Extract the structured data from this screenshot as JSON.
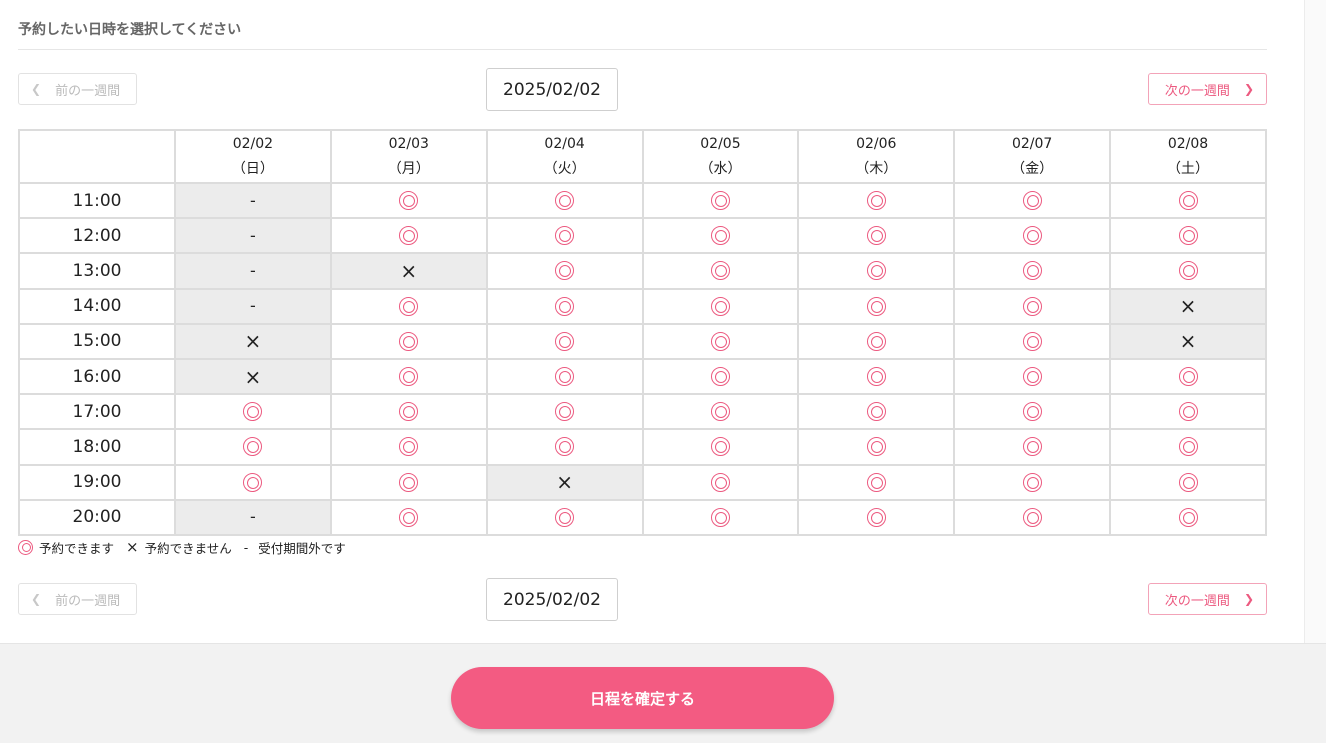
{
  "heading": "予約したい日時を選択してください",
  "nav": {
    "prev_label": "前の一週間",
    "next_label": "次の一週間",
    "current_date": "2025/02/02"
  },
  "days": [
    {
      "date": "02/02",
      "weekday": "（日）"
    },
    {
      "date": "02/03",
      "weekday": "（月）"
    },
    {
      "date": "02/04",
      "weekday": "（火）"
    },
    {
      "date": "02/05",
      "weekday": "（水）"
    },
    {
      "date": "02/06",
      "weekday": "（木）"
    },
    {
      "date": "02/07",
      "weekday": "（金）"
    },
    {
      "date": "02/08",
      "weekday": "（土）"
    }
  ],
  "slots": [
    {
      "time": "11:00",
      "status": [
        "na",
        "ok",
        "ok",
        "ok",
        "ok",
        "ok",
        "ok"
      ]
    },
    {
      "time": "12:00",
      "status": [
        "na",
        "ok",
        "ok",
        "ok",
        "ok",
        "ok",
        "ok"
      ]
    },
    {
      "time": "13:00",
      "status": [
        "na",
        "ng",
        "ok",
        "ok",
        "ok",
        "ok",
        "ok"
      ]
    },
    {
      "time": "14:00",
      "status": [
        "na",
        "ok",
        "ok",
        "ok",
        "ok",
        "ok",
        "ng"
      ]
    },
    {
      "time": "15:00",
      "status": [
        "ng",
        "ok",
        "ok",
        "ok",
        "ok",
        "ok",
        "ng"
      ]
    },
    {
      "time": "16:00",
      "status": [
        "ng",
        "ok",
        "ok",
        "ok",
        "ok",
        "ok",
        "ok"
      ]
    },
    {
      "time": "17:00",
      "status": [
        "ok",
        "ok",
        "ok",
        "ok",
        "ok",
        "ok",
        "ok"
      ]
    },
    {
      "time": "18:00",
      "status": [
        "ok",
        "ok",
        "ok",
        "ok",
        "ok",
        "ok",
        "ok"
      ]
    },
    {
      "time": "19:00",
      "status": [
        "ok",
        "ok",
        "ng",
        "ok",
        "ok",
        "ok",
        "ok"
      ]
    },
    {
      "time": "20:00",
      "status": [
        "na",
        "ok",
        "ok",
        "ok",
        "ok",
        "ok",
        "ok"
      ]
    }
  ],
  "marks": {
    "ng": "×",
    "na": "-"
  },
  "legend": {
    "ok": "予約できます",
    "ng_mark": "×",
    "ng": "予約できません",
    "na_mark": "-",
    "na": "受付期間外です"
  },
  "confirm_label": "日程を確定する",
  "colors": {
    "accent": "#f35b82",
    "cell_gray": "#ececec"
  },
  "icons": {
    "prev": "chevron-left-icon",
    "next": "chevron-right-icon"
  }
}
